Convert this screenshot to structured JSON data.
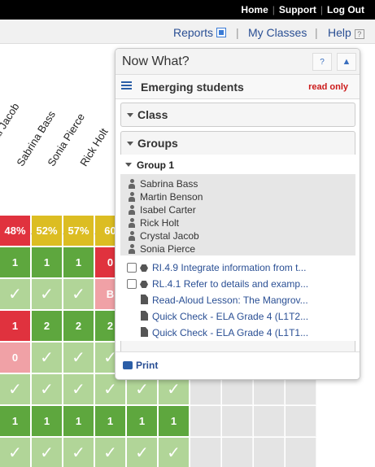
{
  "topbar": {
    "links": [
      "Home",
      "Support",
      "Log Out"
    ]
  },
  "nav": {
    "reports": "Reports",
    "my_classes": "My Classes",
    "help": "Help",
    "help_icon": "?"
  },
  "students_header": [
    {
      "name": "Crystal Jacob",
      "shown": "ystal Jacob"
    },
    {
      "name": "Sabrina Bass",
      "shown": "Sabrina Bass"
    },
    {
      "name": "Sonia Pierce",
      "shown": "Sonia Pierce"
    },
    {
      "name": "Rick Holt",
      "shown": "Rick Holt"
    }
  ],
  "grid": {
    "rows": [
      [
        {
          "t": "48%",
          "c": "red"
        },
        {
          "t": "52%",
          "c": "yellow"
        },
        {
          "t": "57%",
          "c": "yellow"
        },
        {
          "t": "60",
          "c": "yellow"
        }
      ],
      [
        {
          "t": "1",
          "c": "green"
        },
        {
          "t": "1",
          "c": "green"
        },
        {
          "t": "1",
          "c": "green"
        },
        {
          "t": "0",
          "c": "red"
        }
      ],
      [
        {
          "t": "✓",
          "c": "light"
        },
        {
          "t": "✓",
          "c": "light"
        },
        {
          "t": "✓",
          "c": "light"
        },
        {
          "t": "B",
          "c": "pink"
        }
      ],
      [
        {
          "t": "1",
          "c": "red"
        },
        {
          "t": "2",
          "c": "green"
        },
        {
          "t": "2",
          "c": "green"
        },
        {
          "t": "2",
          "c": "green"
        }
      ],
      [
        {
          "t": "0",
          "c": "pink"
        },
        {
          "t": "✓",
          "c": "light"
        },
        {
          "t": "✓",
          "c": "light"
        },
        {
          "t": "✓",
          "c": "light"
        },
        {
          "t": "✓",
          "c": "light"
        },
        {
          "t": "✓",
          "c": "light"
        }
      ],
      [
        {
          "t": "✓",
          "c": "light"
        },
        {
          "t": "✓",
          "c": "light"
        },
        {
          "t": "✓",
          "c": "light"
        },
        {
          "t": "✓",
          "c": "light"
        },
        {
          "t": "✓",
          "c": "light"
        },
        {
          "t": "✓",
          "c": "light"
        }
      ],
      [
        {
          "t": "1",
          "c": "green"
        },
        {
          "t": "1",
          "c": "green"
        },
        {
          "t": "1",
          "c": "green"
        },
        {
          "t": "1",
          "c": "green"
        },
        {
          "t": "1",
          "c": "green"
        },
        {
          "t": "1",
          "c": "green"
        }
      ],
      [
        {
          "t": "✓",
          "c": "light"
        },
        {
          "t": "✓",
          "c": "light"
        },
        {
          "t": "✓",
          "c": "light"
        },
        {
          "t": "✓",
          "c": "light"
        },
        {
          "t": "✓",
          "c": "light"
        },
        {
          "t": "✓",
          "c": "light"
        }
      ]
    ],
    "colors": {
      "red": "#e0323e",
      "yellow": "#dcbd22",
      "green": "#5ea73e",
      "light": "#b1d598",
      "pink": "#f0a1a6",
      "gray": "#e4e4e4"
    }
  },
  "panel": {
    "title": "Now What?",
    "help_btn": "?",
    "collapse_btn": "▲",
    "subtitle": "Emerging students",
    "read_only": "read only",
    "class_section": "Class",
    "groups_section": "Groups",
    "group_title": "Group 1",
    "group_students": [
      "Sabrina Bass",
      "Martin Benson",
      "Isabel Carter",
      "Rick Holt",
      "Crystal Jacob",
      "Sonia Pierce"
    ],
    "items": [
      {
        "label": "RI.4.9 Integrate information from t...",
        "kind": "standard"
      },
      {
        "label": "RL.4.1 Refer to details and examp...",
        "kind": "standard"
      },
      {
        "label": "Read-Aloud Lesson: The Mangrov...",
        "kind": "document"
      },
      {
        "label": "Quick Check - ELA Grade 4 (L1T2...",
        "kind": "document"
      },
      {
        "label": "Quick Check - ELA Grade 4 (L1T1...",
        "kind": "document"
      }
    ],
    "print": "Print"
  }
}
